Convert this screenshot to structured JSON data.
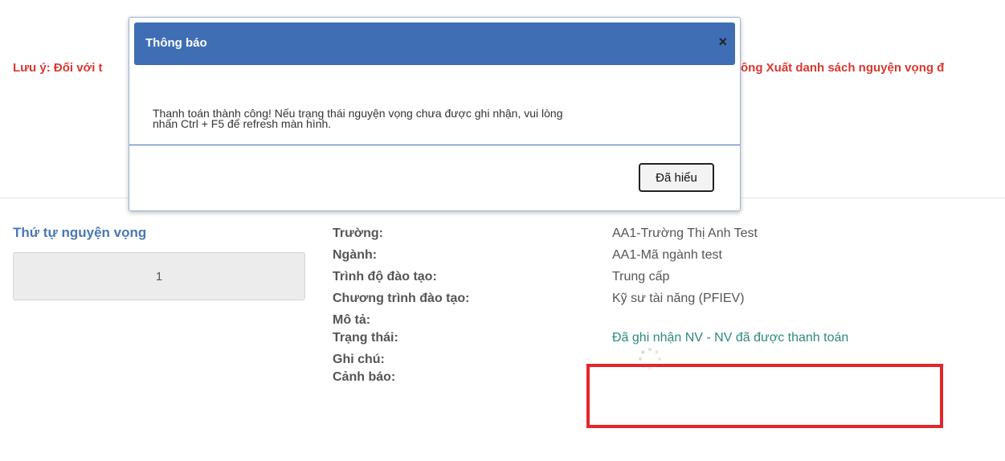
{
  "notice": {
    "left_text": "Lưu ý: Đối với t",
    "right_text": "ông Xuất danh sách nguyện vọng đ"
  },
  "detail": {
    "order_title": "Thứ tự nguyện vọng",
    "order_value": "1",
    "labels": {
      "school": "Trường:",
      "major": "Ngành:",
      "level": "Trình độ đào tạo:",
      "program": "Chương trình đào tạo:",
      "description": "Mô tả:",
      "status": "Trạng thái:",
      "note": "Ghi chú:",
      "warning": "Cảnh báo:"
    },
    "values": {
      "school": "AA1-Trường Thị Anh Test",
      "major": "AA1-Mã ngành test",
      "level": "Trung cấp",
      "program": "Kỹ sư tài năng (PFIEV)",
      "status": "Đã ghi nhận NV - NV đã được thanh toán"
    }
  },
  "modal": {
    "title": "Thông báo",
    "close_symbol": "×",
    "message_line1": "Thanh toán thành công! Nếu trạng thái nguyện vọng chưa được ghi nhận, vui lòng",
    "message_line2": "nhấn Ctrl + F5 để refresh màn hình.",
    "confirm_label": "Đã hiểu"
  },
  "colors": {
    "modal_header": "#3f6eb5",
    "notice_text": "#d9372f",
    "highlight_border": "#e3262b",
    "status_text": "#2f8a7e",
    "order_title": "#4a78b0"
  }
}
